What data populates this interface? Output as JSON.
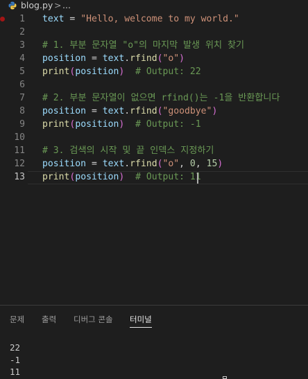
{
  "breadcrumb": {
    "file": "blog.py",
    "separator": ">",
    "rest": "..."
  },
  "editor": {
    "lines": [
      {
        "num": "1",
        "tokens": [
          [
            "v",
            "text"
          ],
          [
            "p",
            " = "
          ],
          [
            "s",
            "\"Hello, welcome to my world.\""
          ]
        ]
      },
      {
        "num": "2",
        "tokens": []
      },
      {
        "num": "3",
        "tokens": [
          [
            "c",
            "# 1. 부분 문자열 \"o\"의 마지막 발생 위치 찾기"
          ]
        ]
      },
      {
        "num": "4",
        "tokens": [
          [
            "v",
            "position"
          ],
          [
            "p",
            " = "
          ],
          [
            "v",
            "text"
          ],
          [
            "p",
            "."
          ],
          [
            "f",
            "rfind"
          ],
          [
            "kr",
            "("
          ],
          [
            "s",
            "\"o\""
          ],
          [
            "kr",
            ")"
          ]
        ]
      },
      {
        "num": "5",
        "tokens": [
          [
            "f",
            "print"
          ],
          [
            "kr",
            "("
          ],
          [
            "v",
            "position"
          ],
          [
            "kr",
            ")"
          ],
          [
            "p",
            "  "
          ],
          [
            "c",
            "# Output: 22"
          ]
        ]
      },
      {
        "num": "6",
        "tokens": []
      },
      {
        "num": "7",
        "tokens": [
          [
            "c",
            "# 2. 부분 문자열이 없으면 rfind()는 -1을 반환합니다"
          ]
        ]
      },
      {
        "num": "8",
        "tokens": [
          [
            "v",
            "position"
          ],
          [
            "p",
            " = "
          ],
          [
            "v",
            "text"
          ],
          [
            "p",
            "."
          ],
          [
            "f",
            "rfind"
          ],
          [
            "kr",
            "("
          ],
          [
            "s",
            "\"goodbye\""
          ],
          [
            "kr",
            ")"
          ]
        ]
      },
      {
        "num": "9",
        "tokens": [
          [
            "f",
            "print"
          ],
          [
            "kr",
            "("
          ],
          [
            "v",
            "position"
          ],
          [
            "kr",
            ")"
          ],
          [
            "p",
            "  "
          ],
          [
            "c",
            "# Output: -1"
          ]
        ]
      },
      {
        "num": "10",
        "tokens": []
      },
      {
        "num": "11",
        "tokens": [
          [
            "c",
            "# 3. 검색의 시작 및 끝 인덱스 지정하기"
          ]
        ]
      },
      {
        "num": "12",
        "tokens": [
          [
            "v",
            "position"
          ],
          [
            "p",
            " = "
          ],
          [
            "v",
            "text"
          ],
          [
            "p",
            "."
          ],
          [
            "f",
            "rfind"
          ],
          [
            "kr",
            "("
          ],
          [
            "s",
            "\"o\""
          ],
          [
            "p",
            ", "
          ],
          [
            "n",
            "0"
          ],
          [
            "p",
            ", "
          ],
          [
            "n",
            "15"
          ],
          [
            "kr",
            ")"
          ]
        ]
      },
      {
        "num": "13",
        "tokens": [
          [
            "f",
            "print"
          ],
          [
            "kr",
            "("
          ],
          [
            "v",
            "position"
          ],
          [
            "kr",
            ")"
          ],
          [
            "p",
            "  "
          ],
          [
            "c",
            "# Output: 11"
          ]
        ]
      }
    ]
  },
  "panel": {
    "tabs": [
      {
        "label": "문제",
        "active": false
      },
      {
        "label": "출력",
        "active": false
      },
      {
        "label": "디버그 콘솔",
        "active": false
      },
      {
        "label": "터미널",
        "active": true
      }
    ],
    "terminal_lines": [
      "22",
      "-1",
      "11"
    ]
  }
}
